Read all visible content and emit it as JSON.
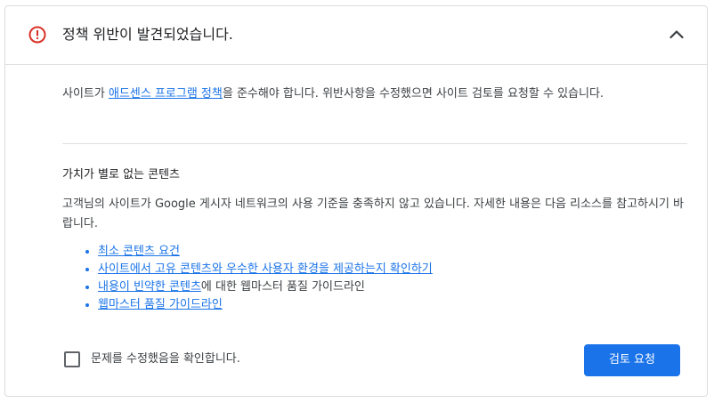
{
  "colors": {
    "accent": "#1a73e8",
    "error": "#d93025",
    "text": "#3c4043",
    "border": "#dadce0"
  },
  "header": {
    "icon": "error-circle-icon",
    "title": "정책 위반이 발견되었습니다.",
    "collapse_icon": "chevron-up-icon"
  },
  "intro": {
    "prefix": "사이트가 ",
    "link": "애드센스 프로그램 정책",
    "suffix": "을 준수해야 합니다. 위반사항을 수정했으면 사이트 검토를 요청할 수 있습니다."
  },
  "section": {
    "title": "가치가 별로 없는 콘텐츠",
    "body": "고객님의 사이트가 Google 게시자 네트워크의 사용 기준을 충족하지 않고 있습니다. 자세한 내용은 다음 리소스를 참고하시기 바랍니다."
  },
  "resources": [
    {
      "link": "최소 콘텐츠 요건",
      "rest": ""
    },
    {
      "link": "사이트에서 고유 콘텐츠와 우수한 사용자 환경을 제공하는지 확인하기",
      "rest": ""
    },
    {
      "link": "내용이 빈약한 콘텐츠",
      "rest": "에 대한 웹마스터 품질 가이드라인"
    },
    {
      "link": "웹마스터 품질 가이드라인",
      "rest": ""
    }
  ],
  "confirm": {
    "label": "문제를 수정했음을 확인합니다.",
    "checked": false
  },
  "review_button": {
    "label": "검토 요청"
  }
}
